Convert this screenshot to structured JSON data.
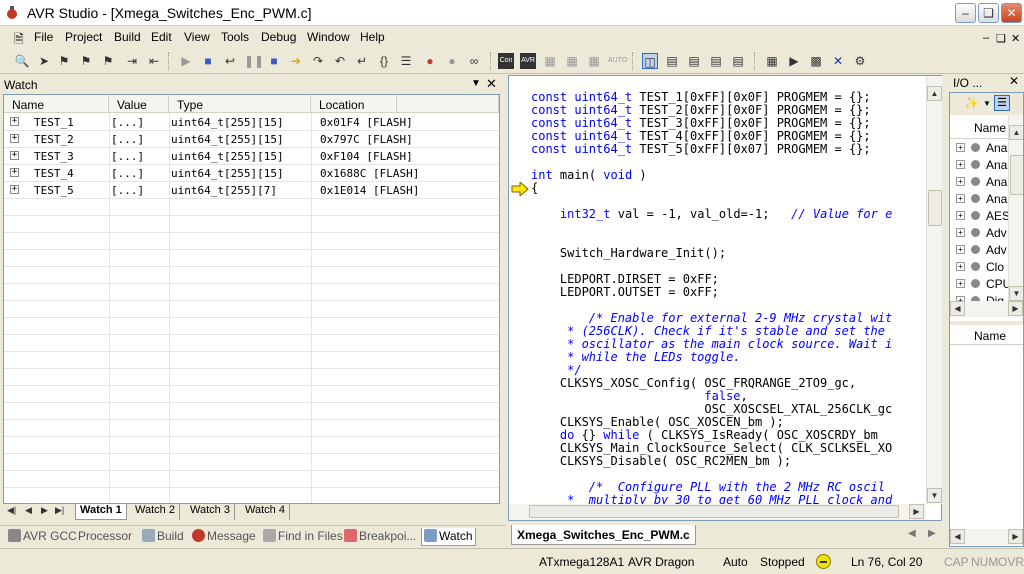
{
  "window": {
    "title": "AVR Studio - [Xmega_Switches_Enc_PWM.c]"
  },
  "menu": [
    "File",
    "Project",
    "Build",
    "Edit",
    "View",
    "Tools",
    "Debug",
    "Window",
    "Help"
  ],
  "watch": {
    "title": "Watch",
    "columns": [
      "Name",
      "Value",
      "Type",
      "Location"
    ],
    "rows": [
      {
        "name": "TEST_1",
        "value": "[...]",
        "type": "uint64_t[255][15]",
        "location": "0x01F4 [FLASH]"
      },
      {
        "name": "TEST_2",
        "value": "[...]",
        "type": "uint64_t[255][15]",
        "location": "0x797C [FLASH]"
      },
      {
        "name": "TEST_3",
        "value": "[...]",
        "type": "uint64_t[255][15]",
        "location": "0xF104 [FLASH]"
      },
      {
        "name": "TEST_4",
        "value": "[...]",
        "type": "uint64_t[255][15]",
        "location": "0x1688C [FLASH]"
      },
      {
        "name": "TEST_5",
        "value": "[...]",
        "type": "uint64_t[255][7]",
        "location": "0x1E014 [FLASH]"
      }
    ],
    "tabs": [
      "Watch 1",
      "Watch 2",
      "Watch 3",
      "Watch 4"
    ]
  },
  "bottom_tabs": [
    "AVR GCC",
    "Processor",
    "Build",
    "Message",
    "Find in Files",
    "Breakpoi...",
    "Watch"
  ],
  "editor": {
    "tab": "Xmega_Switches_Enc_PWM.c",
    "lines": [
      {
        "t": "const uint64_t TEST_1[0xFF][0x0F] PROGMEM = {};"
      },
      {
        "t": "const uint64_t TEST_2[0xFF][0x0F] PROGMEM = {};"
      },
      {
        "t": "const uint64_t TEST_3[0xFF][0x0F] PROGMEM = {};"
      },
      {
        "t": "const uint64_t TEST_4[0xFF][0x0F] PROGMEM = {};"
      },
      {
        "t": "const uint64_t TEST_5[0xFF][0x07] PROGMEM = {};"
      },
      {
        "t": ""
      },
      {
        "t": "int main( void )"
      },
      {
        "t": "{"
      },
      {
        "t": ""
      },
      {
        "t": "    int32_t val = -1, val_old=-1;   // Value for e"
      },
      {
        "t": ""
      },
      {
        "t": ""
      },
      {
        "t": "    Switch_Hardware_Init();"
      },
      {
        "t": ""
      },
      {
        "t": "    LEDPORT.DIRSET = 0xFF;"
      },
      {
        "t": "    LEDPORT.OUTSET = 0xFF;"
      },
      {
        "t": ""
      },
      {
        "t": "        /* Enable for external 2-9 MHz crystal wit"
      },
      {
        "t": "     * (256CLK). Check if it's stable and set the"
      },
      {
        "t": "     * oscillator as the main clock source. Wait i"
      },
      {
        "t": "     * while the LEDs toggle."
      },
      {
        "t": "     */"
      },
      {
        "t": "    CLKSYS_XOSC_Config( OSC_FRQRANGE_2TO9_gc,"
      },
      {
        "t": "                        false,"
      },
      {
        "t": "                        OSC_XOSCSEL_XTAL_256CLK_gc"
      },
      {
        "t": "    CLKSYS_Enable( OSC_XOSCEN_bm );"
      },
      {
        "t": "    do {} while ( CLKSYS_IsReady( OSC_XOSCRDY_bm"
      },
      {
        "t": "    CLKSYS_Main_ClockSource_Select( CLK_SCLKSEL_XO"
      },
      {
        "t": "    CLKSYS_Disable( OSC_RC2MEN_bm );"
      },
      {
        "t": ""
      },
      {
        "t": "        /*  Configure PLL with the 2 MHz RC oscil"
      },
      {
        "t": "     *  multiply by 30 to get 60 MHz PLL clock and"
      }
    ]
  },
  "io_view": {
    "title": "I/O ...",
    "column": "Name",
    "items": [
      "Ana",
      "Ana",
      "Ana",
      "Ana",
      "AES",
      "Adv",
      "Adv",
      "Clo",
      "CPU",
      "Dig"
    ],
    "column2": "Name"
  },
  "status": {
    "device": "ATxmega128A1",
    "tool": "AVR Dragon",
    "mode": "Auto",
    "state": "Stopped",
    "position": "Ln 76, Col 20",
    "cap": "CAP",
    "num": "NUM",
    "ovr": "OVR"
  },
  "colors": {
    "keyword": "#0000ff",
    "comment": "#0000ff",
    "panel": "#ece9d8"
  }
}
